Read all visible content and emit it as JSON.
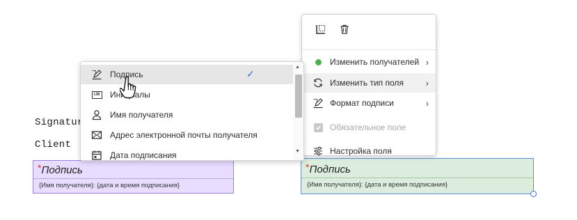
{
  "document": {
    "line1": "Signatur",
    "line2": "Client"
  },
  "fields": {
    "left": {
      "required_mark": "*",
      "title": "Подпись",
      "subtitle": "{Имя получателя}: {дата и время подписания}"
    },
    "right": {
      "required_mark": "*",
      "title": "Подпись",
      "subtitle": "{Имя получателя}: {дата и время подписания}"
    }
  },
  "context_menu": {
    "toolbar": [
      {
        "icon": "select-area-icon"
      },
      {
        "icon": "trash-icon"
      }
    ],
    "items": [
      {
        "label": "Изменить получателей",
        "icon": "green-dot-icon",
        "has_submenu": true
      },
      {
        "label": "Изменить тип поля",
        "icon": "sync-icon",
        "has_submenu": true,
        "hovered": true
      },
      {
        "label": "Формат подписи",
        "icon": "signature-pen-icon",
        "has_submenu": true
      },
      {
        "label": "Обязательное поле",
        "icon": "checkbox-icon",
        "disabled": true
      },
      {
        "label": "Настройка поля",
        "icon": "sliders-icon",
        "has_submenu": false
      }
    ],
    "chevron": "›"
  },
  "field_type_list": {
    "items": [
      {
        "label": "Подпись",
        "icon": "signature-pen-icon",
        "selected": true
      },
      {
        "label": "Инициалы",
        "icon": "initials-icon",
        "init_text": "I.M"
      },
      {
        "label": "Имя получателя",
        "icon": "person-icon"
      },
      {
        "label": "Адрес электронной почты получателя",
        "icon": "envelope-icon"
      },
      {
        "label": "Дата подписания",
        "icon": "calendar-icon"
      }
    ],
    "checkmark": "✓",
    "scroll_up": "▲",
    "scroll_down": "▼"
  },
  "colors": {
    "required": "#e0322e",
    "left_field_bg": "#e8dcff",
    "right_field_bg": "#dcedde",
    "accent": "#3b73c9",
    "recipient_dot": "#4caf50"
  }
}
